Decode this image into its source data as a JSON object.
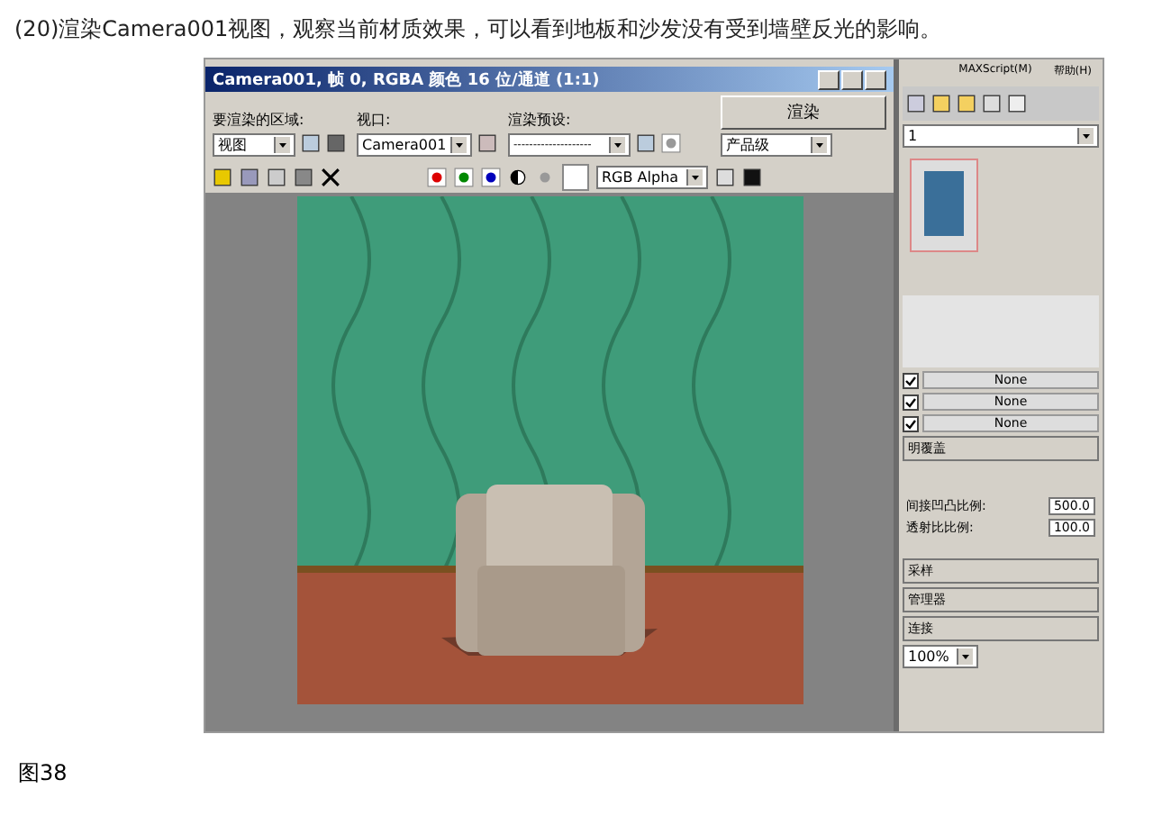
{
  "caption": "(20)渲染Camera001视图，观察当前材质效果，可以看到地板和沙发没有受到墙壁反光的影响。",
  "figure_label": "图38",
  "render_window": {
    "title": "Camera001, 帧 0, RGBA 颜色 16 位/通道 (1:1)",
    "area_label": "要渲染的区域:",
    "area_value": "视图",
    "viewport_label": "视口:",
    "viewport_value": "Camera001",
    "preset_label": "渲染预设:",
    "preset_value": "--------------------",
    "render_button": "渲染",
    "quality_value": "产品级",
    "channel_value": "RGB Alpha"
  },
  "side_panel": {
    "menu": [
      "MAXScript(M)",
      "帮助(H)"
    ],
    "dropdown_value": "1",
    "map_slots": [
      {
        "checked": true,
        "label": "None"
      },
      {
        "checked": true,
        "label": "None"
      },
      {
        "checked": true,
        "label": "None"
      }
    ],
    "override_rollout": "明覆盖",
    "spinners": [
      {
        "label": "间接凹凸比例:",
        "value": "500.0"
      },
      {
        "label": "透射比比例:",
        "value": "100.0"
      }
    ],
    "rollouts": [
      "采样",
      "管理器",
      "连接"
    ],
    "zoom_value": "100%"
  }
}
